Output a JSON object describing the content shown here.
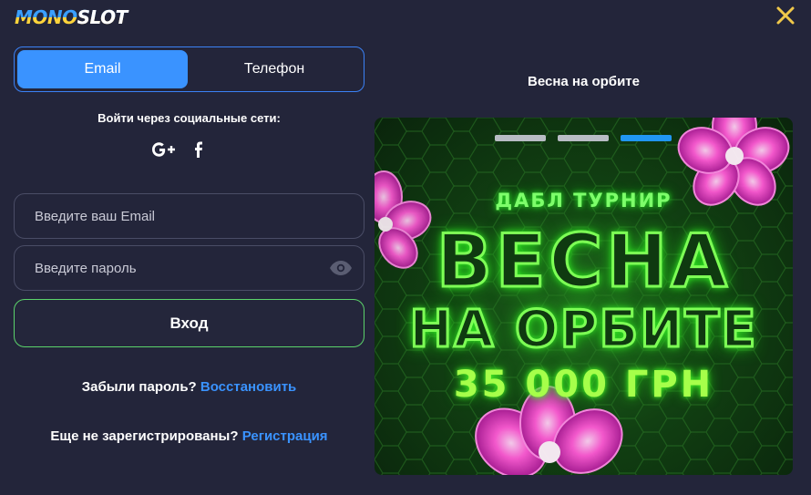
{
  "header": {
    "logo_part1": "MONO",
    "logo_part2": "SLOT",
    "close_icon": "close-icon"
  },
  "tabs": [
    {
      "label": "Email",
      "active": true
    },
    {
      "label": "Телефон",
      "active": false
    }
  ],
  "social": {
    "title": "Войти через социальные сети:",
    "icons": [
      "google-plus-icon",
      "facebook-icon"
    ]
  },
  "form": {
    "email_placeholder": "Введите ваш Email",
    "password_placeholder": "Введите пароль",
    "login_label": "Вход"
  },
  "forgot": {
    "text": "Забыли пароль?",
    "link": "Восстановить"
  },
  "register": {
    "text": "Еще не зарегистрированы?",
    "link": "Регистрация"
  },
  "promo": {
    "title": "Весна на орбите",
    "banner": {
      "subtitle": "ДАБЛ ТУРНИР",
      "line1": "ВЕСНА",
      "line2": "НА ОРБИТЕ",
      "prize": "35 000 ГРН"
    },
    "slides_total": 3,
    "active_slide": 3
  },
  "colors": {
    "background": "#23253a",
    "accent": "#3a93ff",
    "login_border": "#5bd36b",
    "logo_yellow": "#ffd43b",
    "neon_green": "#7dff55",
    "neon_pink": "#ff4fd8"
  }
}
